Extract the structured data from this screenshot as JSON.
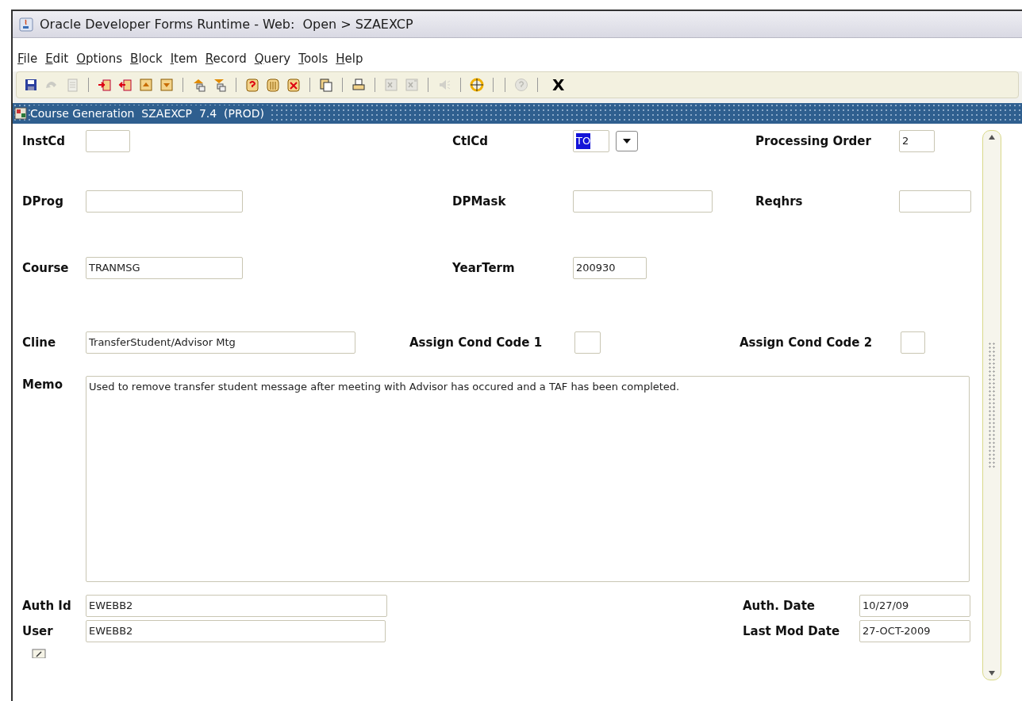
{
  "window": {
    "title": "Oracle Developer Forms Runtime - Web:  Open > SZAEXCP"
  },
  "menu": [
    "File",
    "Edit",
    "Options",
    "Block",
    "Item",
    "Record",
    "Query",
    "Tools",
    "Help"
  ],
  "toolbar": {
    "buttons": [
      {
        "kind": "save",
        "disabled": false
      },
      {
        "kind": "undo",
        "disabled": true
      },
      {
        "kind": "page",
        "disabled": true
      },
      {
        "kind": "sep"
      },
      {
        "kind": "insert",
        "disabled": false
      },
      {
        "kind": "remove",
        "disabled": false
      },
      {
        "kind": "up",
        "disabled": false
      },
      {
        "kind": "down",
        "disabled": false
      },
      {
        "kind": "sep"
      },
      {
        "kind": "prevblock",
        "disabled": false
      },
      {
        "kind": "nextblock",
        "disabled": false
      },
      {
        "kind": "sep"
      },
      {
        "kind": "query",
        "disabled": false
      },
      {
        "kind": "db",
        "disabled": false
      },
      {
        "kind": "cancel",
        "disabled": false
      },
      {
        "kind": "sep"
      },
      {
        "kind": "copy",
        "disabled": false
      },
      {
        "kind": "sep"
      },
      {
        "kind": "print",
        "disabled": false
      },
      {
        "kind": "sep"
      },
      {
        "kind": "xs",
        "disabled": true
      },
      {
        "kind": "xs2",
        "disabled": true
      },
      {
        "kind": "sep"
      },
      {
        "kind": "speaker",
        "disabled": true
      },
      {
        "kind": "sep"
      },
      {
        "kind": "target",
        "disabled": false
      },
      {
        "kind": "sep"
      },
      {
        "kind": "sep"
      },
      {
        "kind": "help",
        "disabled": true
      },
      {
        "kind": "sep"
      }
    ],
    "exit_label": "X"
  },
  "form": {
    "title": "Course Generation  SZAEXCP  7.4  (PROD)",
    "fields": [
      {
        "label": "InstCd"
      },
      {
        "label": "CtlCd",
        "value": "TO",
        "selected": true,
        "dropdown": true
      },
      {
        "label": "Processing Order",
        "value": "2"
      },
      {
        "label": "DProg"
      },
      {
        "label": "DPMask"
      },
      {
        "label": "Reqhrs"
      },
      {
        "label": "Course",
        "value": "TRANMSG"
      },
      {
        "label": "YearTerm",
        "value": "200930"
      },
      {
        "label": "Cline",
        "value": "TransferStudent/Advisor Mtg"
      },
      {
        "label": "Assign Cond Code 1"
      },
      {
        "label": "Assign Cond Code 2"
      },
      {
        "label": "Memo",
        "value": "Used to remove transfer student message after meeting with Advisor has occured and a TAF has been completed."
      },
      {
        "label": "Auth Id",
        "value": "EWEBB2"
      },
      {
        "label": "Auth. Date",
        "value": "10/27/09"
      },
      {
        "label": "User",
        "value": "EWEBB2"
      },
      {
        "label": "Last Mod Date",
        "value": "27-OCT-2009"
      }
    ]
  }
}
